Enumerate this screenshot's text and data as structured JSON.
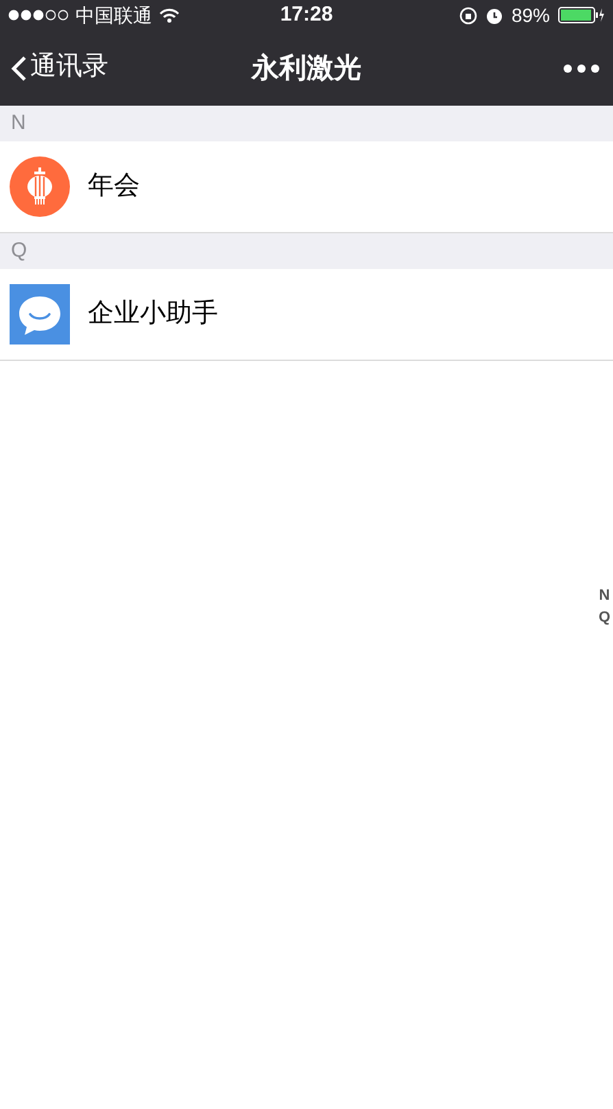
{
  "status_bar": {
    "carrier": "中国联通",
    "time": "17:28",
    "battery": "89%"
  },
  "nav_bar": {
    "back": "通讯录",
    "title": "永利激光"
  },
  "sections": [
    {
      "letter": "N",
      "items": [
        {
          "name": "年会",
          "kind": "lantern"
        }
      ]
    },
    {
      "letter": "Q",
      "items": [
        {
          "name": "企业小助手",
          "kind": "chat"
        }
      ]
    }
  ],
  "index": [
    "N",
    "Q"
  ]
}
